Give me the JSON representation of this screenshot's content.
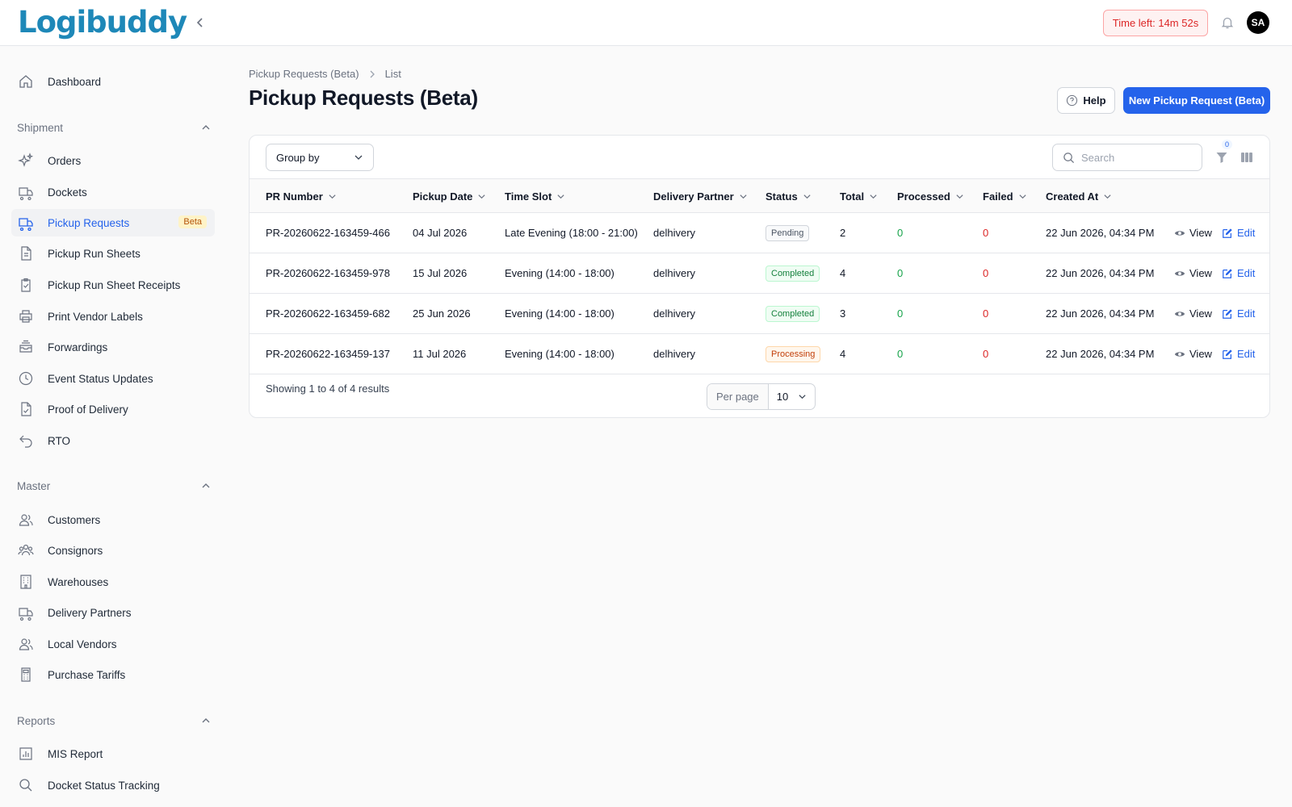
{
  "app": {
    "brand": "Logibuddy"
  },
  "header": {
    "timer": "Time left: 14m 52s",
    "avatar_initials": "SA"
  },
  "sidebar": {
    "top_items": [
      {
        "label": "Dashboard",
        "icon": "home-icon"
      }
    ],
    "sections": [
      {
        "title": "Shipment",
        "items": [
          {
            "label": "Orders",
            "icon": "sparkles-icon"
          },
          {
            "label": "Dockets",
            "icon": "truck-icon"
          },
          {
            "label": "Pickup Requests",
            "icon": "truck-icon",
            "active": true,
            "badge": "Beta"
          },
          {
            "label": "Pickup Run Sheets",
            "icon": "document-icon"
          },
          {
            "label": "Pickup Run Sheet Receipts",
            "icon": "clipboard-check-icon"
          },
          {
            "label": "Print Vendor Labels",
            "icon": "printer-icon"
          },
          {
            "label": "Forwardings",
            "icon": "inbox-stack-icon"
          },
          {
            "label": "Event Status Updates",
            "icon": "clock-icon"
          },
          {
            "label": "Proof of Delivery",
            "icon": "document-check-icon"
          },
          {
            "label": "RTO",
            "icon": "return-arrow-icon"
          }
        ]
      },
      {
        "title": "Master",
        "items": [
          {
            "label": "Customers",
            "icon": "users-icon"
          },
          {
            "label": "Consignors",
            "icon": "user-group-icon"
          },
          {
            "label": "Warehouses",
            "icon": "building-icon"
          },
          {
            "label": "Delivery Partners",
            "icon": "truck-icon"
          },
          {
            "label": "Local Vendors",
            "icon": "users-icon"
          },
          {
            "label": "Purchase Tariffs",
            "icon": "calculator-icon"
          }
        ]
      },
      {
        "title": "Reports",
        "items": [
          {
            "label": "MIS Report",
            "icon": "bar-chart-icon"
          },
          {
            "label": "Docket Status Tracking",
            "icon": "search-icon"
          }
        ]
      }
    ]
  },
  "breadcrumb": {
    "parent": "Pickup Requests (Beta)",
    "current": "List"
  },
  "page": {
    "title": "Pickup Requests (Beta)",
    "help_label": "Help",
    "new_label": "New Pickup Request (Beta)"
  },
  "toolbar": {
    "group_by": "Group by",
    "search_placeholder": "Search",
    "filter_count": "0"
  },
  "table": {
    "columns": [
      "PR Number",
      "Pickup Date",
      "Time Slot",
      "Delivery Partner",
      "Status",
      "Total",
      "Processed",
      "Failed",
      "Created At"
    ],
    "rows": [
      {
        "pr_number": "PR-20260622-163459-466",
        "pickup_date": "04 Jul 2026",
        "time_slot": "Late Evening (18:00 - 21:00)",
        "partner": "delhivery",
        "status": "Pending",
        "total": "2",
        "processed": "0",
        "failed": "0",
        "created_at": "22 Jun 2026, 04:34 PM"
      },
      {
        "pr_number": "PR-20260622-163459-978",
        "pickup_date": "15 Jul 2026",
        "time_slot": "Evening (14:00 - 18:00)",
        "partner": "delhivery",
        "status": "Completed",
        "total": "4",
        "processed": "0",
        "failed": "0",
        "created_at": "22 Jun 2026, 04:34 PM"
      },
      {
        "pr_number": "PR-20260622-163459-682",
        "pickup_date": "25 Jun 2026",
        "time_slot": "Evening (14:00 - 18:00)",
        "partner": "delhivery",
        "status": "Completed",
        "total": "3",
        "processed": "0",
        "failed": "0",
        "created_at": "22 Jun 2026, 04:34 PM"
      },
      {
        "pr_number": "PR-20260622-163459-137",
        "pickup_date": "11 Jul 2026",
        "time_slot": "Evening (14:00 - 18:00)",
        "partner": "delhivery",
        "status": "Processing",
        "total": "4",
        "processed": "0",
        "failed": "0",
        "created_at": "22 Jun 2026, 04:34 PM"
      }
    ],
    "actions": {
      "view": "View",
      "edit": "Edit"
    }
  },
  "footer": {
    "summary": "Showing 1 to 4 of 4 results",
    "per_page_label": "Per page",
    "per_page_value": "10"
  },
  "colors": {
    "accent": "#2563eb",
    "success": "#16a34a",
    "danger": "#dc2626",
    "brand": "#1e88b8"
  }
}
